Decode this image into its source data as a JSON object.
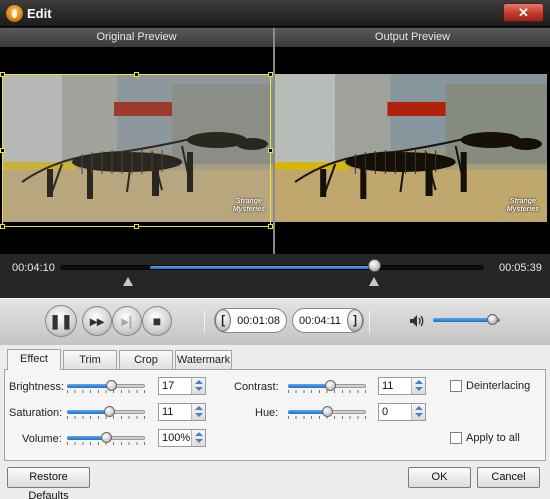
{
  "window": {
    "title": "Edit",
    "close_glyph": "✕"
  },
  "preview": {
    "original_label": "Original Preview",
    "output_label": "Output Preview",
    "watermark_line1": "Strange",
    "watermark_line2": "Mysteries"
  },
  "timeline": {
    "current_time": "00:04:10",
    "total_time": "00:05:39",
    "range_start_fraction": 0.21,
    "range_end_fraction": 0.74
  },
  "controls": {
    "play_glyph": "❚❚",
    "ff_glyph": "▸▸",
    "next_glyph": "▸|",
    "stop_glyph": "■",
    "start_mark_glyph": "[",
    "start_time": "00:01:08",
    "end_time": "00:04:11",
    "end_mark_glyph": "]",
    "volume_fraction": 0.88
  },
  "tabs": [
    {
      "label": "Effect",
      "active": true
    },
    {
      "label": "Trim",
      "active": false
    },
    {
      "label": "Crop",
      "active": false
    },
    {
      "label": "Watermark",
      "active": false
    }
  ],
  "effect": {
    "brightness_label": "Brightness:",
    "brightness_value": "17",
    "brightness_fraction": 0.58,
    "saturation_label": "Saturation:",
    "saturation_value": "11",
    "saturation_fraction": 0.55,
    "volume_label": "Volume:",
    "volume_value": "100%",
    "volume_fraction": 0.5,
    "contrast_label": "Contrast:",
    "contrast_value": "11",
    "contrast_fraction": 0.55,
    "hue_label": "Hue:",
    "hue_value": "0",
    "hue_fraction": 0.5,
    "deinterlacing_label": "Deinterlacing",
    "deinterlacing_checked": false,
    "apply_all_label": "Apply to all",
    "apply_all_checked": false
  },
  "buttons": {
    "restore_defaults": "Restore Defaults",
    "ok": "OK",
    "cancel": "Cancel"
  },
  "colors": {
    "accent_blue": "#1f6fc9",
    "crop_border": "#e8e23c",
    "close_red": "#c0392b"
  }
}
